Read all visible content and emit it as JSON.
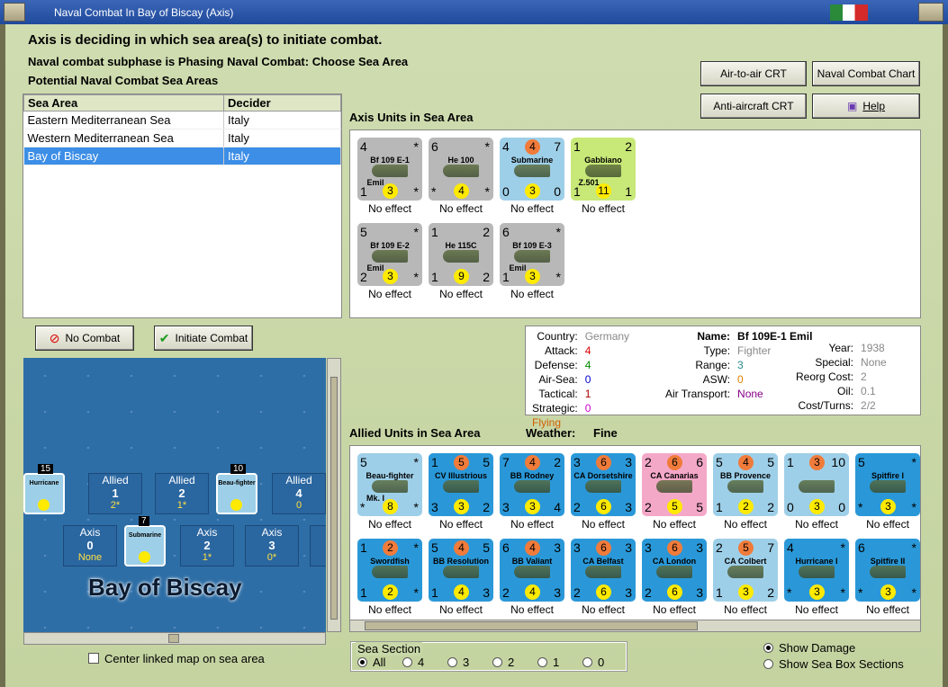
{
  "window": {
    "title": "Naval Combat In Bay of Biscay (Axis)"
  },
  "header": {
    "line1": "Axis is deciding in which sea area(s) to initiate combat.",
    "line2": "Naval combat subphase is Phasing Naval Combat: Choose Sea Area",
    "line3": "Potential Naval Combat Sea Areas"
  },
  "sea_table": {
    "col_area": "Sea Area",
    "col_decider": "Decider",
    "rows": [
      {
        "area": "Eastern Mediterranean Sea",
        "decider": "Italy"
      },
      {
        "area": "Western Mediterranean Sea",
        "decider": "Italy"
      },
      {
        "area": "Bay of Biscay",
        "decider": "Italy"
      }
    ]
  },
  "buttons": {
    "air_crt": "Air-to-air CRT",
    "naval_chart": "Naval Combat Chart",
    "aa_crt": "Anti-aircraft CRT",
    "help": "Help",
    "no_combat": "No Combat",
    "initiate": "Initiate Combat"
  },
  "axis_label": "Axis Units in Sea Area",
  "allied_label": "Allied Units in Sea Area",
  "weather_label": "Weather:",
  "weather": "Fine",
  "effect": "No effect",
  "axis_units": [
    {
      "name": "Bf 109 E-1",
      "sub": "Emil",
      "tl": "4",
      "tr": "*",
      "bl": "1",
      "br": "*",
      "c": "3",
      "bg": "#b8b8b8"
    },
    {
      "name": "He 100",
      "sub": "",
      "tl": "6",
      "tr": "*",
      "bl": "*",
      "br": "*",
      "c": "4",
      "bg": "#b8b8b8"
    },
    {
      "name": "Submarine",
      "sub": "",
      "tl": "4",
      "tr": "7",
      "bl": "0",
      "br": "0",
      "c": "3",
      "top": "4",
      "bg": "#9ecfe8"
    },
    {
      "name": "Gabbiano",
      "sub": "Z.501",
      "tl": "1",
      "tr": "2",
      "bl": "1",
      "br": "1",
      "c": "11",
      "bg": "#c8e878"
    },
    {
      "name": "Bf 109 E-2",
      "sub": "Emil",
      "tl": "5",
      "tr": "*",
      "bl": "2",
      "br": "*",
      "c": "3",
      "bg": "#b8b8b8"
    },
    {
      "name": "He 115C",
      "sub": "",
      "tl": "1",
      "tr": "2",
      "bl": "1",
      "br": "2",
      "c": "9",
      "bg": "#b8b8b8"
    },
    {
      "name": "Bf 109 E-3",
      "sub": "Emil",
      "tl": "6",
      "tr": "*",
      "bl": "1",
      "br": "*",
      "c": "3",
      "bg": "#b8b8b8"
    }
  ],
  "info": {
    "country_l": "Country:",
    "country": "Germany",
    "attack_l": "Attack:",
    "attack": "4",
    "defense_l": "Defense:",
    "defense": "4",
    "airsea_l": "Air-Sea:",
    "airsea": "0",
    "tactical_l": "Tactical:",
    "tactical": "1",
    "strategic_l": "Strategic:",
    "strategic": "0",
    "status": "Flying",
    "name_l": "Name:",
    "name": "Bf 109E-1 Emil",
    "type_l": "Type:",
    "type": "Fighter",
    "range_l": "Range:",
    "range": "3",
    "asw_l": "ASW:",
    "asw": "0",
    "airtrans_l": "Air Transport:",
    "airtrans": "None",
    "year_l": "Year:",
    "year": "1938",
    "special_l": "Special:",
    "special": "None",
    "reorg_l": "Reorg Cost:",
    "reorg": "2",
    "oil_l": "Oil:",
    "oil": "0.1",
    "cost_l": "Cost/Turns:",
    "cost": "2/2"
  },
  "allied_units": [
    {
      "name": "Beau-fighter",
      "sub": "Mk. I",
      "tl": "5",
      "tr": "*",
      "bl": "*",
      "br": "*",
      "c": "8",
      "bg": "#9ecfe8"
    },
    {
      "name": "CV Illustrious",
      "tl": "1",
      "mid": "5",
      "tr": "5",
      "bl": "3",
      "br": "2",
      "c": "3",
      "bg": "#2a98d8"
    },
    {
      "name": "BB Rodney",
      "tl": "7",
      "mid": "4",
      "tr": "2",
      "bl": "3",
      "br": "4",
      "c": "3",
      "bg": "#2a98d8"
    },
    {
      "name": "CA Dorsetshire",
      "tl": "3",
      "mid": "6",
      "tr": "3",
      "bl": "2",
      "br": "3",
      "c": "6",
      "bg": "#2a98d8"
    },
    {
      "name": "CA Canarias",
      "tl": "2",
      "mid": "6",
      "tr": "6",
      "bl": "2",
      "br": "5",
      "c": "5",
      "bg": "#f4a8c8"
    },
    {
      "name": "BB Provence",
      "tl": "5",
      "mid": "4",
      "tr": "5",
      "bl": "1",
      "br": "2",
      "c": "2",
      "bg": "#9ecfe8"
    },
    {
      "name": "",
      "tl": "1",
      "mid": "3",
      "tr": "10",
      "bl": "0",
      "br": "0",
      "c": "3",
      "bg": "#9ecfe8"
    },
    {
      "name": "Spitfire I",
      "tl": "5",
      "tr": "*",
      "bl": "*",
      "br": "*",
      "c": "3",
      "bg": "#2a98d8"
    },
    {
      "name": "Swordfish",
      "tl": "1",
      "mid": "2",
      "tr": "*",
      "bl": "1",
      "br": "*",
      "c": "2",
      "bg": "#2a98d8"
    },
    {
      "name": "BB Resolution",
      "tl": "5",
      "mid": "4",
      "tr": "5",
      "bl": "1",
      "br": "3",
      "c": "4",
      "bg": "#2a98d8"
    },
    {
      "name": "BB Valiant",
      "tl": "6",
      "mid": "4",
      "tr": "3",
      "bl": "2",
      "br": "3",
      "c": "4",
      "bg": "#2a98d8"
    },
    {
      "name": "CA Belfast",
      "tl": "3",
      "mid": "6",
      "tr": "3",
      "bl": "2",
      "br": "3",
      "c": "6",
      "bg": "#2a98d8"
    },
    {
      "name": "CA London",
      "tl": "3",
      "mid": "6",
      "tr": "3",
      "bl": "2",
      "br": "3",
      "c": "6",
      "bg": "#2a98d8"
    },
    {
      "name": "CA Colbert",
      "tl": "2",
      "mid": "5",
      "tr": "7",
      "bl": "1",
      "br": "2",
      "c": "3",
      "bg": "#9ecfe8"
    },
    {
      "name": "Hurricane I",
      "tl": "4",
      "tr": "*",
      "bl": "*",
      "br": "*",
      "c": "3",
      "bg": "#2a98d8"
    },
    {
      "name": "Spitfire II",
      "tl": "6",
      "tr": "*",
      "bl": "*",
      "br": "*",
      "c": "3",
      "bg": "#2a98d8"
    }
  ],
  "map": {
    "title": "Bay of Biscay",
    "boxes": [
      {
        "side": "Allied",
        "v": "1",
        "s": "2*"
      },
      {
        "side": "Allied",
        "v": "2",
        "s": "1*"
      },
      {
        "side": "Allied",
        "v": "4",
        "s": "0"
      },
      {
        "side": "Axis",
        "v": "0",
        "s": "None"
      },
      {
        "side": "Axis",
        "v": "2",
        "s": "1*"
      },
      {
        "side": "Axis",
        "v": "3",
        "s": "0*"
      },
      {
        "side": "A",
        "v": "",
        "s": ""
      }
    ],
    "stack1": "15",
    "stack2": "10",
    "stack3": "7",
    "hurricane": "Hurricane",
    "beau": "Beau-fighter",
    "sub": "Submarine"
  },
  "center_label": "Center linked map on sea area",
  "sea_section": {
    "label": "Sea Section",
    "options": [
      "All",
      "4",
      "3",
      "2",
      "1",
      "0"
    ]
  },
  "show_damage": "Show Damage",
  "show_boxes": "Show Sea Box Sections"
}
